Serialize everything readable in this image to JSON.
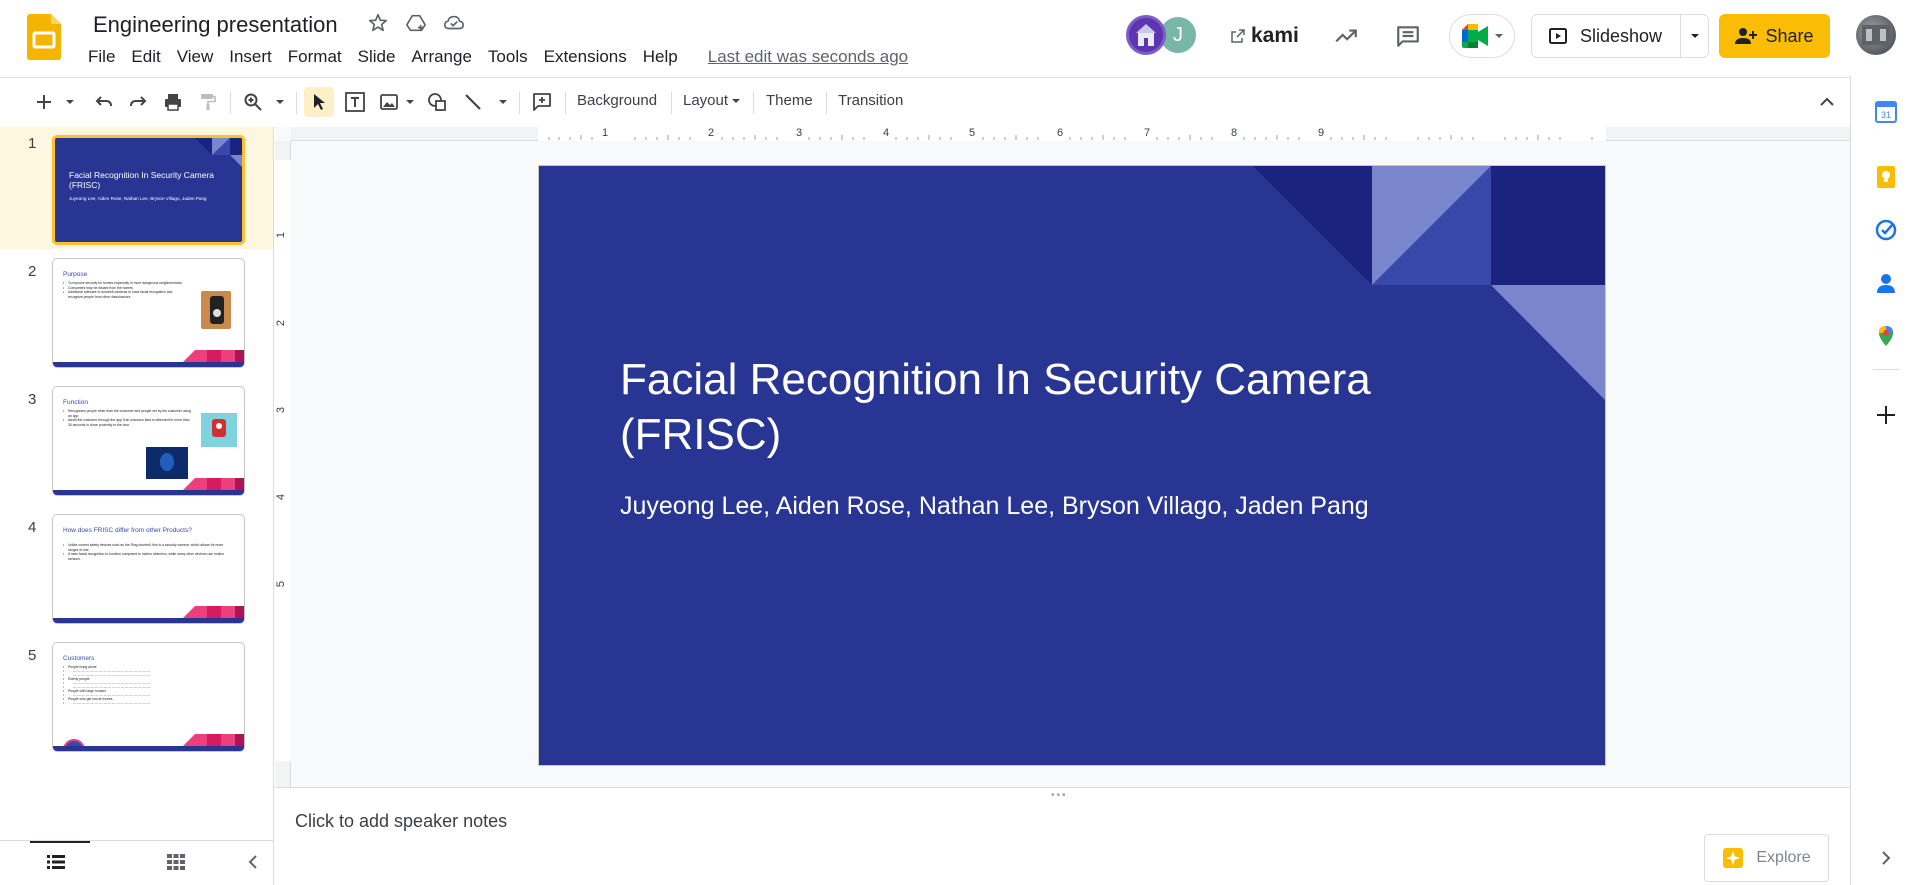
{
  "document": {
    "title": "Engineering presentation"
  },
  "menu": [
    "File",
    "Edit",
    "View",
    "Insert",
    "Format",
    "Slide",
    "Arrange",
    "Tools",
    "Extensions",
    "Help"
  ],
  "last_edit": "Last edit was seconds ago",
  "header": {
    "avatar2_initial": "J",
    "kami_label": "kami",
    "slideshow_label": "Slideshow",
    "share_label": "Share"
  },
  "toolbar": {
    "background_label": "Background",
    "layout_label": "Layout",
    "theme_label": "Theme",
    "transition_label": "Transition"
  },
  "ruler": {
    "h_numbers": [
      "1",
      "2",
      "3",
      "4",
      "5",
      "6",
      "7",
      "8",
      "9"
    ],
    "v_numbers": [
      "1",
      "2",
      "3",
      "4",
      "5"
    ]
  },
  "slide": {
    "title": "Facial Recognition In Security Camera (FRISC)",
    "subtitle": "Juyeong Lee, Aiden Rose, Nathan Lee, Bryson Villago, Jaden Pang"
  },
  "filmstrip": [
    {
      "number": "1",
      "title": "Facial Recognition In Security Camera (FRISC)",
      "subtitle": "Juyeong Lee, Aiden Rose, Nathan Lee, Bryson Villago, Jaden Pang",
      "selected": true
    },
    {
      "number": "2",
      "title": "Purpose",
      "bullets": [
        "To improve security for homes especially in more dangerous neighborheads",
        "Consumers may be distant from the homes",
        "Additional software to doorbell cameras to have facial recognition and recognize people from other disturbances"
      ]
    },
    {
      "number": "3",
      "title": "Function",
      "bullets": [
        "Recognizes people other than the customer and people set by the customer using an app",
        "Alerts the customer through the app if an unknown face is detected for more than 30 seconds in close proximity to the door"
      ]
    },
    {
      "number": "4",
      "title": "How does FRISC differ from other Products?",
      "bullets": [
        "Unlike current safety devices such as the Ring doorbell, this is a security camera, which allows for more ranges of use.",
        "It uses facial recognition to function compared to motion detection, while many other devices use motion sensors."
      ]
    },
    {
      "number": "5",
      "title": "Customers",
      "bullets": [
        "People living alone",
        "Elderly people",
        "People with large houses",
        "People who get lost at homes"
      ]
    }
  ],
  "notes": {
    "placeholder": "Click to add speaker notes"
  },
  "explore": {
    "label": "Explore"
  },
  "colors": {
    "slide_bg": "#283593",
    "accent_yellow": "#fbbc04",
    "selection": "#fbc02d"
  }
}
